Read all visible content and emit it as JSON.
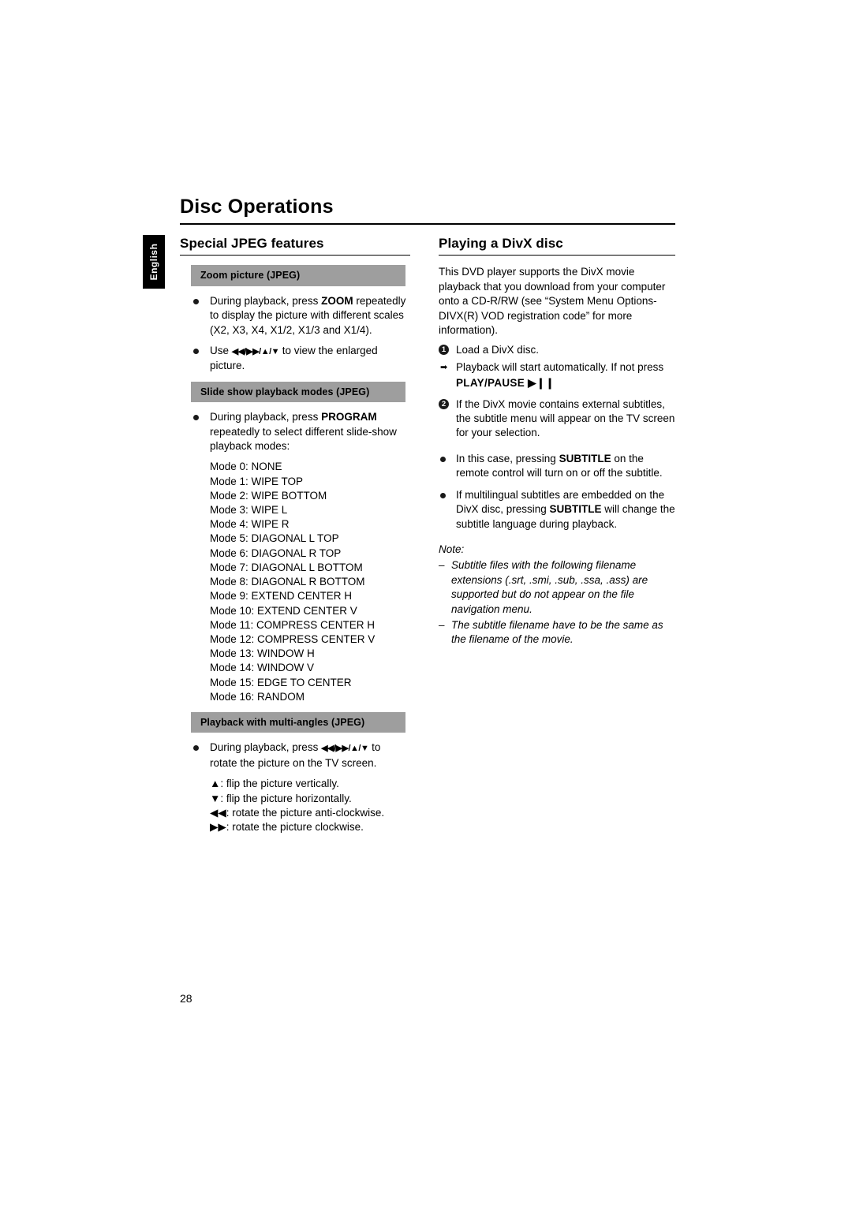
{
  "document": {
    "page_title": "Disc Operations",
    "language_tab": "English",
    "page_number": "28"
  },
  "left_column": {
    "heading": "Special JPEG features",
    "sections": [
      {
        "bar": "Zoom picture (JPEG)",
        "bullets": [
          "During playback, press ZOOM repeatedly to display the picture with different scales (X2, X3, X4, X1/2, X1/3 and X1/4).",
          "Use ◀◀/▶▶/▲/▼ to view the enlarged picture."
        ]
      },
      {
        "bar": "Slide show playback modes (JPEG)",
        "bullets": [
          "During playback, press PROGRAM repeatedly to select different slide-show playback modes:"
        ],
        "modes": [
          "Mode 0: NONE",
          "Mode 1: WIPE TOP",
          "Mode 2: WIPE BOTTOM",
          "Mode 3: WIPE L",
          "Mode 4: WIPE R",
          "Mode 5: DIAGONAL L TOP",
          "Mode 6: DIAGONAL R TOP",
          "Mode 7: DIAGONAL L BOTTOM",
          "Mode 8: DIAGONAL R BOTTOM",
          "Mode 9: EXTEND CENTER H",
          "Mode 10: EXTEND CENTER V",
          "Mode 11: COMPRESS CENTER H",
          "Mode 12: COMPRESS CENTER V",
          "Mode 13: WINDOW H",
          "Mode 14: WINDOW V",
          "Mode 15: EDGE TO CENTER",
          "Mode 16:  RANDOM"
        ]
      },
      {
        "bar": "Playback with multi-angles (JPEG)",
        "bullets": [
          "During playback, press ◀◀/▶▶/▲/▼ to rotate the picture on the TV screen."
        ],
        "rotations": [
          "▲: flip the picture vertically.",
          "▼: flip the picture horizontally.",
          "◀◀:  rotate the picture anti-clockwise.",
          "▶▶:  rotate the picture clockwise."
        ]
      }
    ]
  },
  "right_column": {
    "heading": "Playing a DivX disc",
    "intro": "This DVD player supports the DivX movie playback that you download from your computer onto a CD-R/RW (see “System Menu Options-DIVX(R) VOD registration code” for more information).",
    "steps": [
      {
        "number": "1",
        "text": "Load a DivX disc.",
        "arrow": "Playback will start automatically. If not press",
        "bold_line": "PLAY/PAUSE ▶❙❙"
      },
      {
        "number": "2",
        "text": "If the DivX movie contains external subtitles, the subtitle menu will appear on the TV screen for your selection."
      }
    ],
    "bullets": [
      "In this case, pressing SUBTITLE on the remote control will turn on or off the subtitle.",
      "If multilingual subtitles are embedded on the DivX disc, pressing SUBTITLE will change the subtitle language during playback."
    ],
    "note_heading": "Note:",
    "notes": [
      "Subtitle files with the following filename extensions (.srt, .smi, .sub, .ssa, .ass) are supported but do not appear on the file navigation menu.",
      "The subtitle filename have to be the same as the filename of the movie."
    ]
  }
}
